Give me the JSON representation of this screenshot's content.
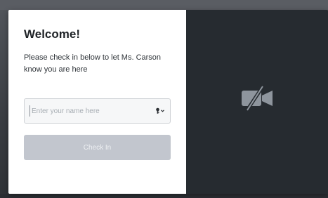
{
  "modal": {
    "title": "Welcome!",
    "message": "Please check in below to let Ms. Carson know you are here",
    "name_field": {
      "value": "",
      "placeholder": "Enter your name here"
    },
    "checkin_label": "Check In"
  },
  "video": {
    "status_icon": "camera-off-icon"
  },
  "colors": {
    "button_disabled": "#c2c6ce",
    "video_bg": "#262b30"
  }
}
